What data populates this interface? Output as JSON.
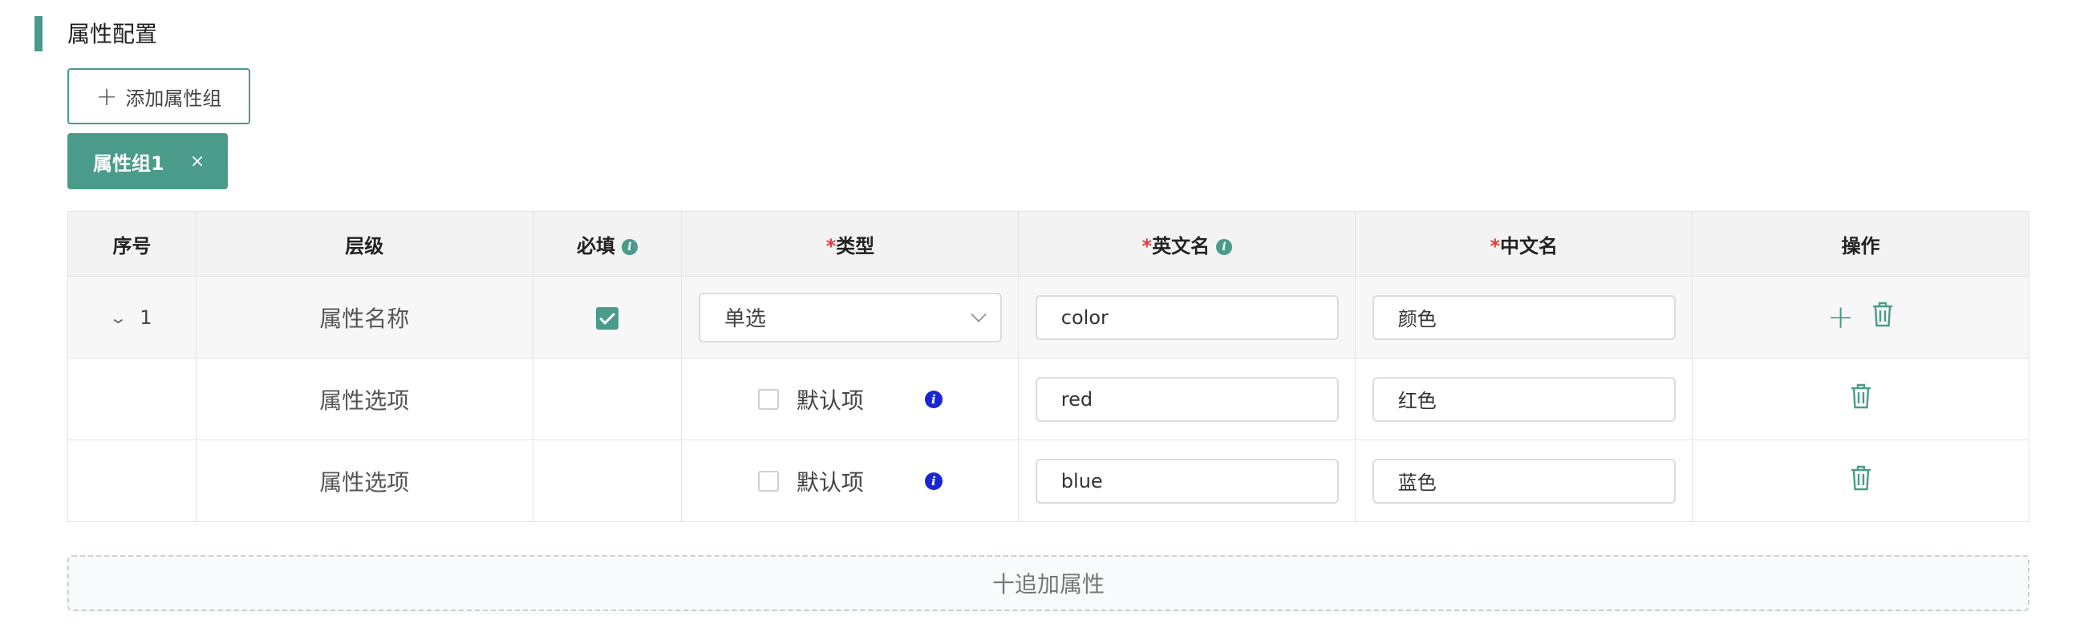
{
  "section": {
    "title": "属性配置"
  },
  "add_group": {
    "icon": "+",
    "label": "添加属性组"
  },
  "group_tag": {
    "label": "属性组1",
    "close": "×"
  },
  "table": {
    "headers": {
      "seq": "序号",
      "level": "层级",
      "required": "必填",
      "type": "类型",
      "en_name": "英文名",
      "cn_name": "中文名",
      "ops": "操作"
    },
    "required_mark": "*",
    "info_glyph": "i",
    "rows": [
      {
        "seq": "1",
        "level": "属性名称",
        "required": true,
        "type": "单选",
        "en": "color",
        "cn": "颜色"
      },
      {
        "level": "属性选项",
        "default_label": "默认项",
        "en": "red",
        "cn": "红色"
      },
      {
        "level": "属性选项",
        "default_label": "默认项",
        "en": "blue",
        "cn": "蓝色"
      }
    ]
  },
  "add_attr": {
    "label": "十追加属性"
  },
  "colors": {
    "accent": "#4a9b8a",
    "required": "#e03b3b",
    "info_blue": "#1a26d6"
  }
}
